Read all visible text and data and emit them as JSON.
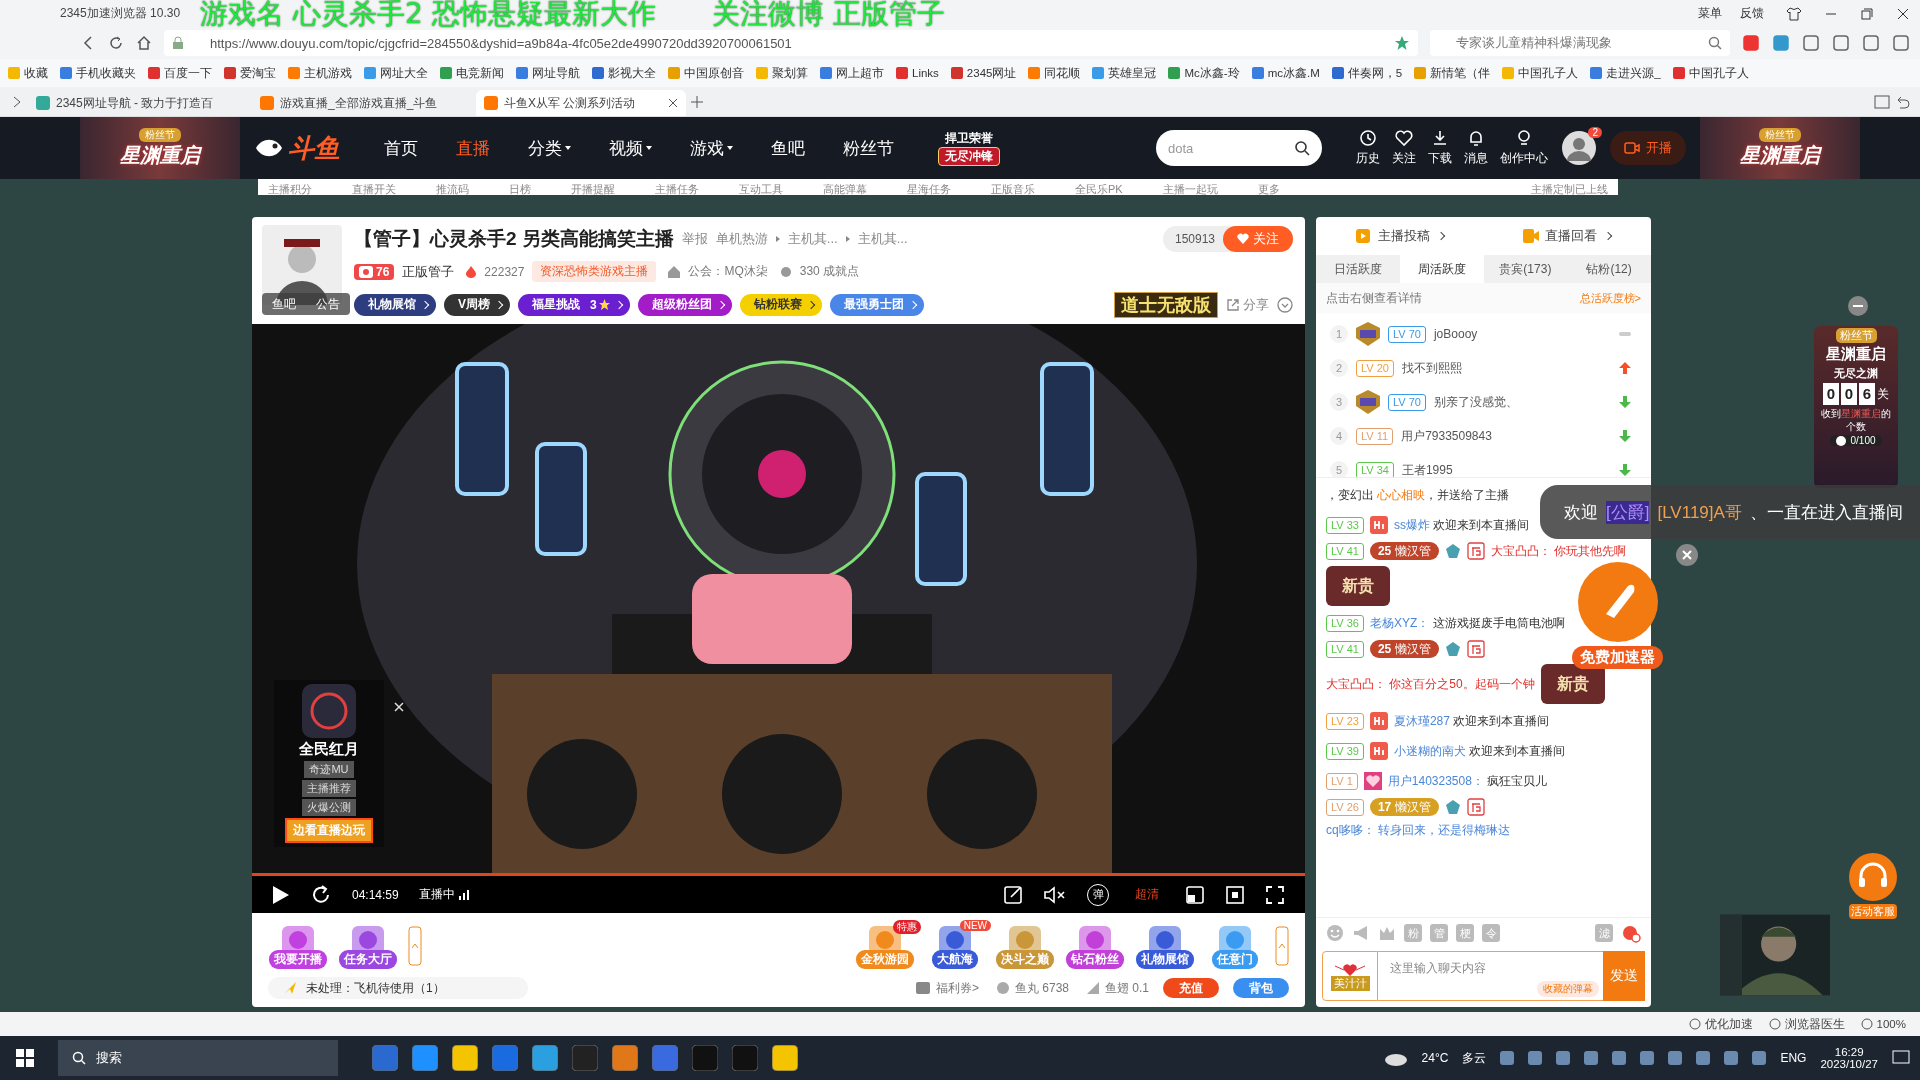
{
  "overlay_caption": "游戏名 心灵杀手2 恐怖悬疑最新大作　　关注微博 正版管子",
  "browser": {
    "title": "2345加速浏览器 10.30",
    "menu": [
      "菜单",
      "反馈"
    ],
    "url": "https://www.douyu.com/topic/cjgcfrid=284550&dyshid=a9b84a-4fc05e2de4990720dd3920700061501",
    "search": {
      "value": "专家谈儿童精神科爆满现象"
    },
    "bookmarks": [
      "收藏",
      "手机收藏夹",
      "百度一下",
      "爱淘宝",
      "主机游戏",
      "网址大全",
      "电竞新闻",
      "网址导航",
      "影视大全",
      "中国原创音",
      "聚划算",
      "网上超市",
      "Links",
      "2345网址",
      "同花顺",
      "英雄皇冠",
      "Mc冰鑫-玲",
      "mc冰鑫.M",
      "伴奏网，5",
      "新情笔（伴",
      "中国孔子人",
      "走进兴源_",
      "中国孔子人"
    ],
    "tabs": [
      {
        "label": "2345网址导航 - 致力于打造百",
        "selected": false
      },
      {
        "label": "游戏直播_全部游戏直播_斗鱼",
        "selected": false
      },
      {
        "label": "斗鱼X从军 公测系列活动",
        "selected": true
      }
    ]
  },
  "site_header": {
    "logo": "斗鱼",
    "banner": {
      "badge": "粉丝节",
      "title": "星渊重启"
    },
    "nav": [
      {
        "label": "首页",
        "selected": false,
        "dropdown": false
      },
      {
        "label": "直播",
        "selected": true,
        "dropdown": false
      },
      {
        "label": "分类",
        "selected": false,
        "dropdown": true
      },
      {
        "label": "视频",
        "selected": false,
        "dropdown": true
      },
      {
        "label": "游戏",
        "selected": false,
        "dropdown": true
      },
      {
        "label": "鱼吧",
        "selected": false,
        "dropdown": false
      },
      {
        "label": "粉丝节",
        "selected": false,
        "dropdown": false
      }
    ],
    "promo": {
      "top": "捍卫荣誉",
      "bottom": "无尽冲锋"
    },
    "search": {
      "value": "dota"
    },
    "actions": [
      "历史",
      "关注",
      "下载",
      "消息",
      "创作中心"
    ],
    "notification_count": "2",
    "live_button": "开播",
    "banner_right": {
      "badge": "粉丝节",
      "title": "星渊重启"
    }
  },
  "sub_nav": [
    "主播积分",
    "直播开关",
    "推流码",
    "日榜",
    "开播提醒",
    "主播任务",
    "互动工具",
    "高能弹幕",
    "星海任务",
    "正版音乐",
    "全民乐PK",
    "主播一起玩",
    "更多",
    "主播定制已上线"
  ],
  "room": {
    "title": "【管子】心灵杀手2 另类高能搞笑主播",
    "report": "举报",
    "breadcrumbs": [
      "单机热游",
      "主机其...",
      "主机其..."
    ],
    "level": "76",
    "anchor": "正版管子",
    "heat": "222327",
    "tag": "资深恐怖类游戏主播",
    "guild": "公会：MQ沐柒",
    "achievements": "330 成就点",
    "followers": "150913",
    "follow": "关注",
    "avatar_links": [
      "鱼吧",
      "公告"
    ],
    "badges": [
      {
        "label": "礼物展馆",
        "color": "#2d3d80"
      },
      {
        "label": "V周榜",
        "color": "#333333"
      },
      {
        "label": "福星挑战",
        "count": "3",
        "color": "#6a1fd0"
      },
      {
        "label": "超级粉丝团",
        "color": "#a21cc8"
      },
      {
        "label": "钻粉联赛",
        "color": "#f5d000"
      },
      {
        "label": "最强勇士团",
        "color": "#4a86e8"
      }
    ],
    "promo": "道士无敌版",
    "share": "分享"
  },
  "video": {
    "kind": "picture",
    "ad": {
      "title": "全民红月",
      "tags": [
        "奇迹MU",
        "主播推荐",
        "火爆公测"
      ],
      "button": "边看直播边玩"
    }
  },
  "controls": {
    "time": "04:14:59",
    "status": "直播中",
    "danmaku": "弹",
    "quality": "超清"
  },
  "gift_bar": {
    "left": [
      "我要开播",
      "任务大厅"
    ],
    "gifts": [
      {
        "label": "金秋游园",
        "tag": "特惠",
        "color": "#f08a1c"
      },
      {
        "label": "大航海",
        "tag": "NEW",
        "color": "#3a5bd8"
      },
      {
        "label": "决斗之巅",
        "color": "#c9963a"
      },
      {
        "label": "钻石粉丝",
        "color": "#c040d8"
      },
      {
        "label": "礼物展馆",
        "color": "#3a5bd8"
      },
      {
        "label": "任意门",
        "color": "#3a9bf0"
      }
    ],
    "notice": "未处理：飞机待使用（1）",
    "coupons": "福利券>",
    "fish_balls": "鱼丸 6738",
    "fish_wings": "鱼翅 0.1",
    "recharge": "充值",
    "backpack": "背包"
  },
  "chat_panel": {
    "links": [
      "主播投稿",
      "直播回看"
    ],
    "tabs": [
      {
        "label": "日活跃度",
        "selected": false
      },
      {
        "label": "周活跃度",
        "selected": true
      },
      {
        "label": "贵宾(173)",
        "selected": false
      },
      {
        "label": "钻粉(12)",
        "selected": false
      }
    ],
    "hint": "点击右侧查看详情",
    "rank_link": "总活跃度榜>",
    "ranks": [
      {
        "rank": "1",
        "level": "LV 70",
        "color": "#3a9be8",
        "name": "joBoooy",
        "noble": true,
        "kind": "steady"
      },
      {
        "rank": "2",
        "level": "LV 20",
        "color": "#f0a040",
        "name": "找不到熙熙",
        "noble": false,
        "kind": "up"
      },
      {
        "rank": "3",
        "level": "LV 70",
        "color": "#3a9be8",
        "name": "别亲了没感觉、",
        "noble": true,
        "kind": "down"
      },
      {
        "rank": "4",
        "level": "LV 11",
        "color": "#e0a070",
        "name": "用户7933509843",
        "noble": false,
        "kind": "down"
      },
      {
        "rank": "5",
        "level": "LV 34",
        "color": "#5cc84a",
        "name": "王者1995",
        "noble": false,
        "kind": "down"
      }
    ],
    "messages": [
      {
        "kind": "gift",
        "before": "，变幻出 ",
        "gift": "心心相映",
        "after": "，并送给了主播"
      },
      {
        "kind": "chat",
        "level": "LV 33",
        "color": "#5cc84a",
        "hi": true,
        "name": "ss爆炸",
        "text": "欢迎来到本直播间",
        "admin": false
      },
      {
        "kind": "chat",
        "level": "LV 41",
        "color": "#5cc84a",
        "fan": {
          "level": "25",
          "name": "懒汉管"
        },
        "admin": true,
        "hi": false,
        "name": "大宝凸凸：",
        "text": "你玩其他先啊",
        "noble": "新贵",
        "red": true
      },
      {
        "kind": "chat",
        "level": "LV 36",
        "color": "#5cc84a",
        "hi": false,
        "admin": false,
        "name": "老杨XYZ：",
        "text": "这游戏挺废手电筒电池啊"
      },
      {
        "kind": "chat",
        "level": "LV 41",
        "color": "#5cc84a",
        "fan": {
          "level": "25",
          "name": "懒汉管"
        },
        "admin": true,
        "hi": false,
        "name": "大宝凸凸：",
        "text": "你这百分之50。起码一个钟",
        "noble": "新贵",
        "red": true
      },
      {
        "kind": "chat",
        "level": "LV 23",
        "color": "#f0a040",
        "hi": true,
        "admin": false,
        "name": "夏沐瑾287",
        "text": "欢迎来到本直播间"
      },
      {
        "kind": "chat",
        "level": "LV 39",
        "color": "#5cc84a",
        "hi": true,
        "admin": false,
        "name": "小迷糊的南犬",
        "text": "欢迎来到本直播间"
      },
      {
        "kind": "chat",
        "level": "LV 1",
        "color": "#e0a070",
        "hi": false,
        "admin": false,
        "heart": true,
        "name": "用户140323508：",
        "text": "疯狂宝贝儿"
      },
      {
        "kind": "chat",
        "level": "LV 26",
        "color": "#e0a070",
        "fan": {
          "level": "17",
          "name": "懒汉管",
          "gold": true
        },
        "admin": true,
        "hi": false,
        "name": "cq哆哆：",
        "text": "转身回来，还是得梅琳达",
        "blue": true
      }
    ],
    "tools": [
      "粉",
      "管",
      "梗",
      "令"
    ],
    "filter": "滤",
    "badge": "美汁汁",
    "input": {
      "placeholder": "这里输入聊天内容"
    },
    "saved": "收藏的弹幕",
    "send": "发送"
  },
  "accelerator": {
    "label": "免费加速器"
  },
  "welcome_toast": {
    "prefix": "欢迎",
    "noble": "[公爵]",
    "user": "[LV119]A哥",
    "suffix": "、一直在进入直播间"
  },
  "side_widget": {
    "badge": "粉丝节",
    "title": "星渊重启",
    "stage": "无尽之渊",
    "digits": [
      "0",
      "0",
      "6"
    ],
    "unit": "关",
    "caption_1": "收到",
    "caption_2": "星渊重启",
    "caption_3": "的个数",
    "progress": "0/100"
  },
  "service": "活动客服",
  "status_bar": [
    "优化加速",
    "浏览器医生",
    "100%"
  ],
  "taskbar": {
    "search": "搜索",
    "weather_temp": "24°C",
    "weather": "多云",
    "lang": "ENG",
    "time": "16:29",
    "date": "2023/10/27"
  }
}
